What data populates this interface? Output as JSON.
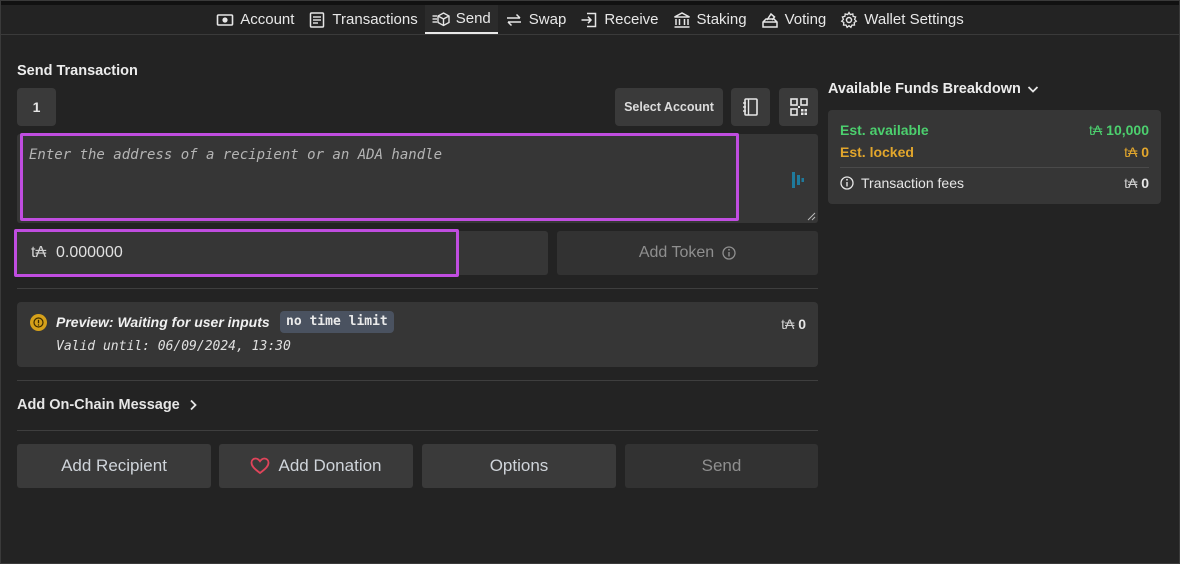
{
  "nav": {
    "items": [
      {
        "label": "Account",
        "icon": "account-icon"
      },
      {
        "label": "Transactions",
        "icon": "transactions-icon"
      },
      {
        "label": "Send",
        "icon": "send-icon",
        "active": true
      },
      {
        "label": "Swap",
        "icon": "swap-icon"
      },
      {
        "label": "Receive",
        "icon": "receive-icon"
      },
      {
        "label": "Staking",
        "icon": "staking-icon"
      },
      {
        "label": "Voting",
        "icon": "voting-icon"
      },
      {
        "label": "Wallet Settings",
        "icon": "gear-icon"
      }
    ]
  },
  "send": {
    "title": "Send Transaction",
    "recipient_index": "1",
    "select_account_label": "Select Account",
    "address_placeholder": "Enter the address of a recipient or an ADA handle",
    "currency_symbol": "t₳",
    "amount_value": "0.000000",
    "add_token_label": "Add Token"
  },
  "preview": {
    "title": "Preview: Waiting for user inputs",
    "badge": "no time limit",
    "valid_until": "Valid until: 06/09/2024, 13:30",
    "amount_currency": "t₳",
    "amount": "0"
  },
  "onchain_message_label": "Add On-Chain Message",
  "buttons": {
    "add_recipient": "Add Recipient",
    "add_donation": "Add Donation",
    "options": "Options",
    "send": "Send"
  },
  "funds": {
    "title": "Available Funds Breakdown",
    "available_label": "Est. available",
    "available_currency": "t₳",
    "available_value": "10,000",
    "locked_label": "Est. locked",
    "locked_currency": "t₳",
    "locked_value": "0",
    "fees_label": "Transaction fees",
    "fees_currency": "t₳",
    "fees_value": "0"
  },
  "colors": {
    "accent_highlight": "#c04de0",
    "available": "#4ccf6e",
    "locked": "#e2a62c",
    "preview_badge": "#4a5260"
  }
}
